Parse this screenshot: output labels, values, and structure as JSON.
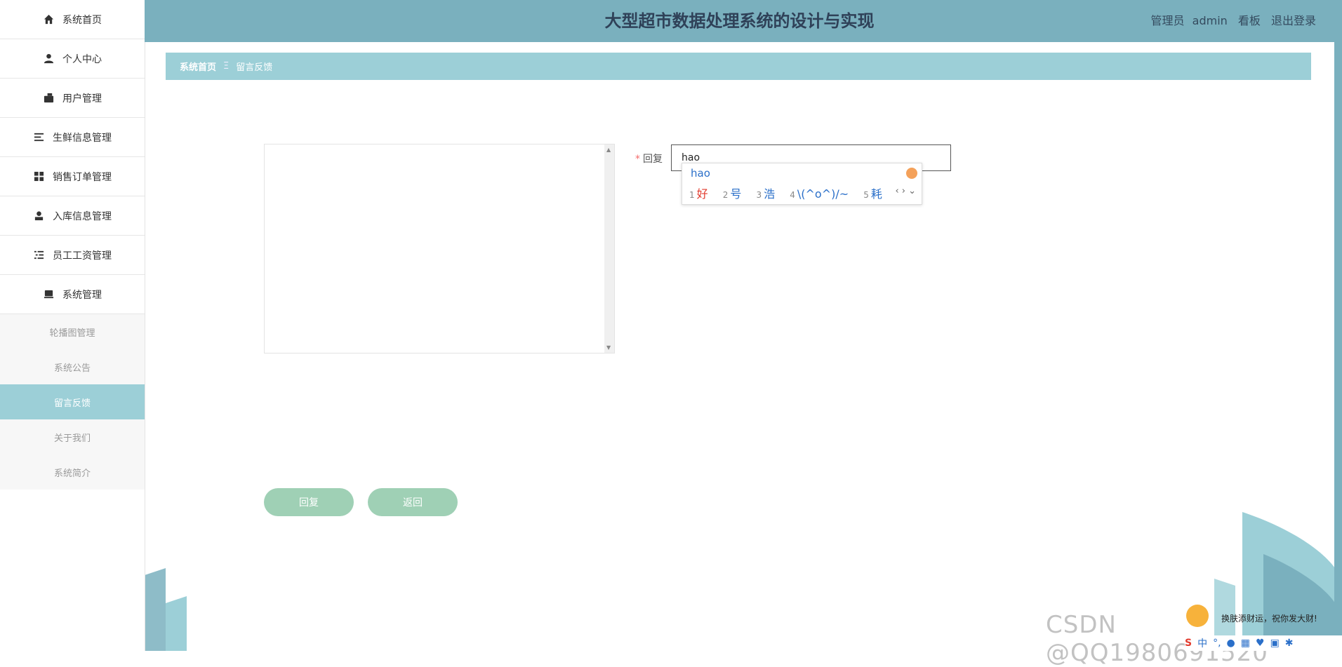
{
  "header": {
    "title": "大型超市数据处理系统的设计与实现",
    "user_role": "管理员",
    "username": "admin",
    "dashboard_link": "看板",
    "logout_link": "退出登录"
  },
  "sidebar": {
    "items": [
      {
        "label": "系统首页",
        "icon": "home-icon"
      },
      {
        "label": "个人中心",
        "icon": "person-icon"
      },
      {
        "label": "用户管理",
        "icon": "wallet-icon"
      },
      {
        "label": "生鲜信息管理",
        "icon": "list-icon"
      },
      {
        "label": "销售订单管理",
        "icon": "grid-icon"
      },
      {
        "label": "入库信息管理",
        "icon": "user-icon"
      },
      {
        "label": "员工工资管理",
        "icon": "checklist-icon"
      },
      {
        "label": "系统管理",
        "icon": "monitor-icon"
      }
    ],
    "subitems": [
      {
        "label": "轮播图管理"
      },
      {
        "label": "系统公告"
      },
      {
        "label": "留言反馈",
        "active": true
      },
      {
        "label": "关于我们"
      },
      {
        "label": "系统简介"
      }
    ]
  },
  "breadcrumb": {
    "home": "系统首页",
    "separator": "Ξ",
    "current": "留言反馈"
  },
  "form": {
    "reply_label": "回复",
    "required_mark": "*",
    "reply_value": "hao"
  },
  "ime": {
    "pinyin": "hao",
    "candidates": [
      {
        "n": "1",
        "text": "好"
      },
      {
        "n": "2",
        "text": "号"
      },
      {
        "n": "3",
        "text": "浩"
      },
      {
        "n": "4",
        "text": "\\(^o^)/~"
      },
      {
        "n": "5",
        "text": "耗"
      }
    ],
    "nav": "‹ › ⌄"
  },
  "buttons": {
    "reply": "回复",
    "back": "返回"
  },
  "overlay": {
    "watermark": "CSDN @QQ1980691520",
    "tray_message": "换肤添财运，祝你发大财!",
    "tray_lang": "中"
  },
  "colors": {
    "header_bg": "#7ab0be",
    "breadcrumb_bg": "#9ccfd7",
    "active_menu_bg": "#9ccfd7",
    "button_bg": "#9fd0b5"
  }
}
